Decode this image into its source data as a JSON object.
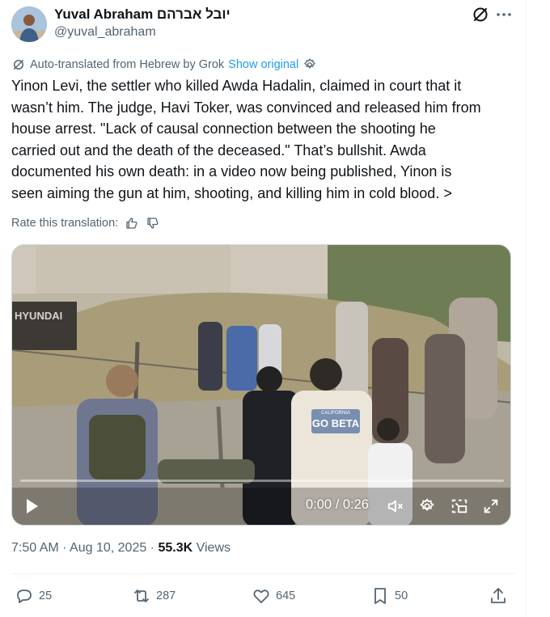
{
  "author": {
    "display_name": "Yuval Abraham יובל אברהם",
    "handle": "@yuval_abraham",
    "avatar_icon": "profile-photo"
  },
  "translation": {
    "notice": "Auto-translated from Hebrew by Grok",
    "show_original": "Show original",
    "rate_label": "Rate this translation:"
  },
  "post_lines": [
    "Yinon Levi, the settler who killed Awda Hadalin, claimed in court that it",
    "wasn’t him. The judge, Havi Toker, was convinced and released him from",
    "house arrest. \"Lack of causal connection between the shooting he",
    "carried out and the death of the deceased.\" That’s bullshit. Awda",
    "documented his own death: in a video now being published, Yinon is",
    "seen aiming the gun at him, shooting, and killing him in cold blood. >"
  ],
  "video": {
    "time": "0:00 / 0:26",
    "progress": 0,
    "machine_brand": "HYUNDAI",
    "shirt_text_top": "CALIFORNIA",
    "shirt_text_main": "GO BETA"
  },
  "meta": {
    "timestamp": "7:50 AM · Aug 10, 2025 · ",
    "views_count": "55.3K",
    "views_label": " Views"
  },
  "actions": {
    "replies": "25",
    "reposts": "287",
    "likes": "645",
    "bookmarks": "50"
  },
  "colors": {
    "link": "#1d9bf0",
    "secondary_text": "#536471",
    "primary_text": "#0f1419"
  }
}
